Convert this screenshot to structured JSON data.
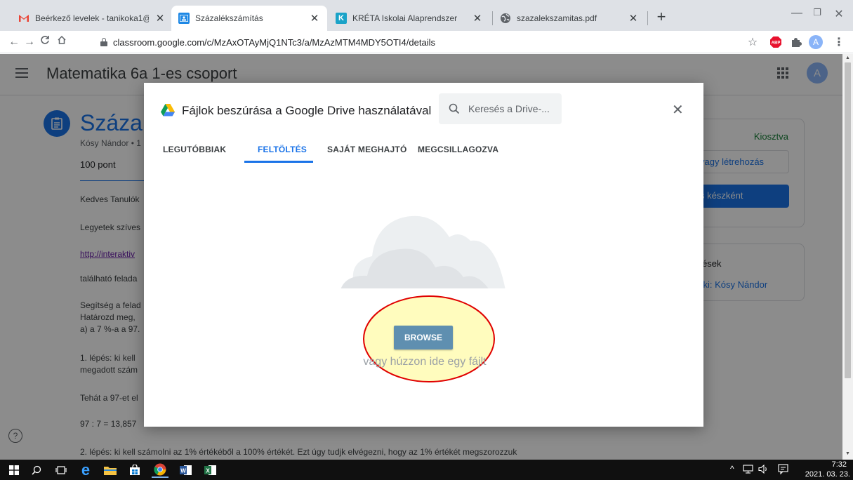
{
  "browser": {
    "tabs": [
      {
        "title": "Beérkező levelek - tanikoka1@gm",
        "active": false
      },
      {
        "title": "Százalékszámítás",
        "active": true
      },
      {
        "title": "KRÉTA Iskolai Alaprendszer",
        "active": false
      },
      {
        "title": "szazalekszamitas.pdf",
        "active": false
      }
    ],
    "url": "classroom.google.com/c/MzAxOTAyMjQ1NTc3/a/MzAzMTM4MDY5OTI4/details",
    "profile_initial": "A",
    "abp_label": "ABP"
  },
  "classroom": {
    "class_title": "Matematika 6a 1-es csoport",
    "avatar_initial": "A",
    "assignment_title": "Százalé",
    "author_line": "Kósy Nándor • 1",
    "points": "100 pont",
    "body_lines": [
      "Kedves Tanulók",
      "Legyetek szíves",
      "http://interaktiv",
      "található felada",
      "Segítség a felad",
      "Határozd meg,",
      "a) a 7 %-a a 97.",
      "1. lépés: ki kell",
      "megadott szám",
      "Tehát a 97-et el",
      "97 : 7 = 13,857",
      "2. lépés: ki kell számolni az 1% értékéből a 100% értékét. Ezt úgy tudjk elvégezni, hogy az 1% értékét megszorozzuk"
    ],
    "side_card": {
      "status": "Kiosztva",
      "add_button": "vagy létrehozás",
      "mark_done_button": "s készként"
    },
    "comments_card": {
      "title": "yzések",
      "link": "neki: Kósy Nándor"
    },
    "help_icon": "?"
  },
  "dialog": {
    "title": "Fájlok beszúrása a Google Drive használatával",
    "search_placeholder": "Keresés a Drive-...",
    "tabs": [
      "LEGUTÓBBIAK",
      "FELTÖLTÉS",
      "SAJÁT MEGHAJTÓ",
      "MEGCSILLAGOZVA"
    ],
    "active_tab_index": 1,
    "browse_button": "BROWSE",
    "drop_hint": "vagy húzzon ide egy fájlt"
  },
  "taskbar": {
    "time": "7:32",
    "date": "2021. 03. 23."
  },
  "colors": {
    "accent_blue": "#1a73e8",
    "browse_button": "#5f8fb0",
    "highlight_fill": "#fffbb3",
    "highlight_stroke": "#e00000",
    "kiosztva_green": "#188038"
  }
}
